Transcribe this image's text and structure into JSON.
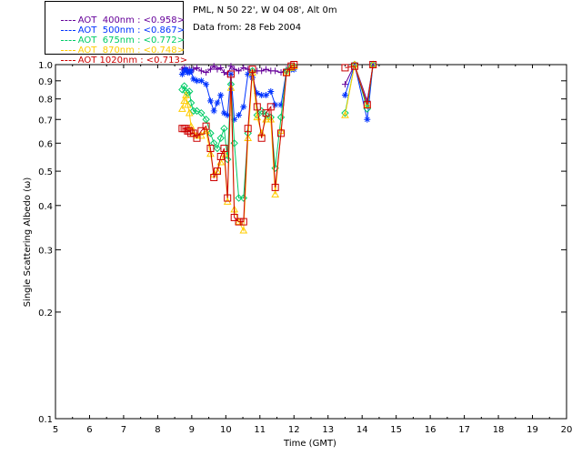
{
  "info": {
    "station": "PML, N 50 22', W 04 08', Alt 0m",
    "date": "Data from: 28 Feb 2004"
  },
  "chart_data": {
    "type": "scatter",
    "title": "",
    "xlabel": "Time (GMT)",
    "ylabel": "Single Scattering Albedo (ω)",
    "xlim": [
      5,
      20
    ],
    "ylim": [
      0.1,
      1.0
    ],
    "yscale": "log",
    "xticks": [
      5,
      6,
      7,
      8,
      9,
      10,
      11,
      12,
      13,
      14,
      15,
      16,
      17,
      18,
      19,
      20
    ],
    "yticks": [
      0.1,
      0.2,
      0.3,
      0.4,
      0.5,
      0.6,
      0.7,
      0.8,
      0.9,
      1.0
    ],
    "ytick_labels": [
      "0.1",
      "0.2",
      "0.3",
      "0.4",
      "0.5",
      "0.6",
      "0.7",
      "0.8",
      "0.9",
      "1.0"
    ],
    "grid": false,
    "legend_position": "top-left outside",
    "series": [
      {
        "name": "AOT  400nm : <0.958>",
        "color": "#660099",
        "marker": "plus",
        "x": [
          8.72,
          8.78,
          8.83,
          8.88,
          8.93,
          8.98,
          9.05,
          9.15,
          9.28,
          9.42,
          9.55,
          9.65,
          9.75,
          9.85,
          9.95,
          10.05,
          10.15,
          10.25,
          10.38,
          10.52,
          10.65,
          10.78,
          10.92,
          11.05,
          11.18,
          11.32,
          11.45,
          11.62,
          11.78,
          11.92,
          12.0,
          13.5,
          13.78,
          14.15,
          14.32
        ],
        "y": [
          0.97,
          0.98,
          0.97,
          0.96,
          0.97,
          0.96,
          0.97,
          0.98,
          0.96,
          0.95,
          0.97,
          0.99,
          0.97,
          0.98,
          0.95,
          0.94,
          0.99,
          0.97,
          0.96,
          0.98,
          0.97,
          0.96,
          0.96,
          0.96,
          0.97,
          0.96,
          0.96,
          0.95,
          0.97,
          0.98,
          0.99,
          0.88,
          1.0,
          0.79,
          1.0
        ]
      },
      {
        "name": "AOT  500nm : <0.867>",
        "color": "#0033ff",
        "marker": "asterisk",
        "x": [
          8.72,
          8.78,
          8.83,
          8.88,
          8.93,
          8.98,
          9.05,
          9.15,
          9.28,
          9.42,
          9.55,
          9.65,
          9.75,
          9.85,
          9.95,
          10.05,
          10.15,
          10.25,
          10.38,
          10.52,
          10.65,
          10.78,
          10.92,
          11.05,
          11.18,
          11.32,
          11.45,
          11.62,
          11.78,
          11.92,
          12.0,
          13.5,
          13.78,
          14.15,
          14.32
        ],
        "y": [
          0.94,
          0.96,
          0.97,
          0.95,
          0.95,
          0.96,
          0.91,
          0.9,
          0.9,
          0.88,
          0.79,
          0.74,
          0.78,
          0.82,
          0.73,
          0.72,
          0.94,
          0.7,
          0.72,
          0.76,
          0.94,
          0.92,
          0.83,
          0.82,
          0.82,
          0.84,
          0.77,
          0.77,
          0.96,
          0.97,
          0.97,
          0.82,
          1.0,
          0.7,
          1.0
        ]
      },
      {
        "name": "AOT  675nm : <0.772>",
        "color": "#00cc66",
        "marker": "diamond",
        "x": [
          8.72,
          8.78,
          8.83,
          8.88,
          8.93,
          8.98,
          9.05,
          9.15,
          9.28,
          9.42,
          9.55,
          9.65,
          9.75,
          9.85,
          9.95,
          10.05,
          10.15,
          10.25,
          10.38,
          10.52,
          10.65,
          10.78,
          10.92,
          11.05,
          11.18,
          11.32,
          11.45,
          11.62,
          11.78,
          11.92,
          12.0,
          13.5,
          13.78,
          14.15,
          14.32
        ],
        "y": [
          0.85,
          0.87,
          0.84,
          0.83,
          0.84,
          0.78,
          0.74,
          0.74,
          0.73,
          0.7,
          0.64,
          0.6,
          0.58,
          0.62,
          0.66,
          0.54,
          0.88,
          0.6,
          0.42,
          0.42,
          0.64,
          0.96,
          0.72,
          0.74,
          0.72,
          0.71,
          0.51,
          0.71,
          0.96,
          0.98,
          0.99,
          0.73,
          1.0,
          0.75,
          1.0
        ]
      },
      {
        "name": "AOT  870nm : <0.748>",
        "color": "#ffcc00",
        "marker": "triangle",
        "x": [
          8.72,
          8.78,
          8.83,
          8.88,
          8.93,
          8.98,
          9.05,
          9.15,
          9.28,
          9.42,
          9.55,
          9.65,
          9.75,
          9.85,
          9.95,
          10.05,
          10.15,
          10.25,
          10.38,
          10.52,
          10.65,
          10.78,
          10.92,
          11.05,
          11.18,
          11.32,
          11.45,
          11.62,
          11.78,
          11.92,
          12.0,
          13.5,
          13.78,
          14.15,
          14.32
        ],
        "y": [
          0.75,
          0.79,
          0.82,
          0.77,
          0.73,
          0.67,
          0.64,
          0.63,
          0.63,
          0.65,
          0.56,
          0.49,
          0.5,
          0.53,
          0.56,
          0.41,
          0.86,
          0.39,
          0.36,
          0.34,
          0.62,
          0.95,
          0.71,
          0.64,
          0.7,
          0.7,
          0.43,
          0.65,
          0.95,
          0.98,
          0.99,
          0.72,
          1.0,
          0.77,
          1.0
        ]
      },
      {
        "name": "AOT 1020nm : <0.713>",
        "color": "#cc0000",
        "marker": "square",
        "x": [
          8.72,
          8.78,
          8.83,
          8.88,
          8.93,
          8.98,
          9.05,
          9.15,
          9.28,
          9.42,
          9.55,
          9.65,
          9.75,
          9.85,
          9.95,
          10.05,
          10.15,
          10.25,
          10.38,
          10.52,
          10.65,
          10.78,
          10.92,
          11.05,
          11.18,
          11.32,
          11.45,
          11.62,
          11.78,
          11.92,
          12.0,
          13.5,
          13.78,
          14.15,
          14.32
        ],
        "y": [
          0.66,
          0.66,
          0.66,
          0.65,
          0.65,
          0.64,
          0.64,
          0.62,
          0.65,
          0.67,
          0.58,
          0.48,
          0.5,
          0.55,
          0.58,
          0.42,
          0.94,
          0.37,
          0.36,
          0.36,
          0.66,
          0.97,
          0.76,
          0.62,
          0.73,
          0.76,
          0.45,
          0.64,
          0.95,
          0.99,
          1.0,
          0.98,
          0.99,
          0.77,
          1.0
        ]
      }
    ]
  }
}
